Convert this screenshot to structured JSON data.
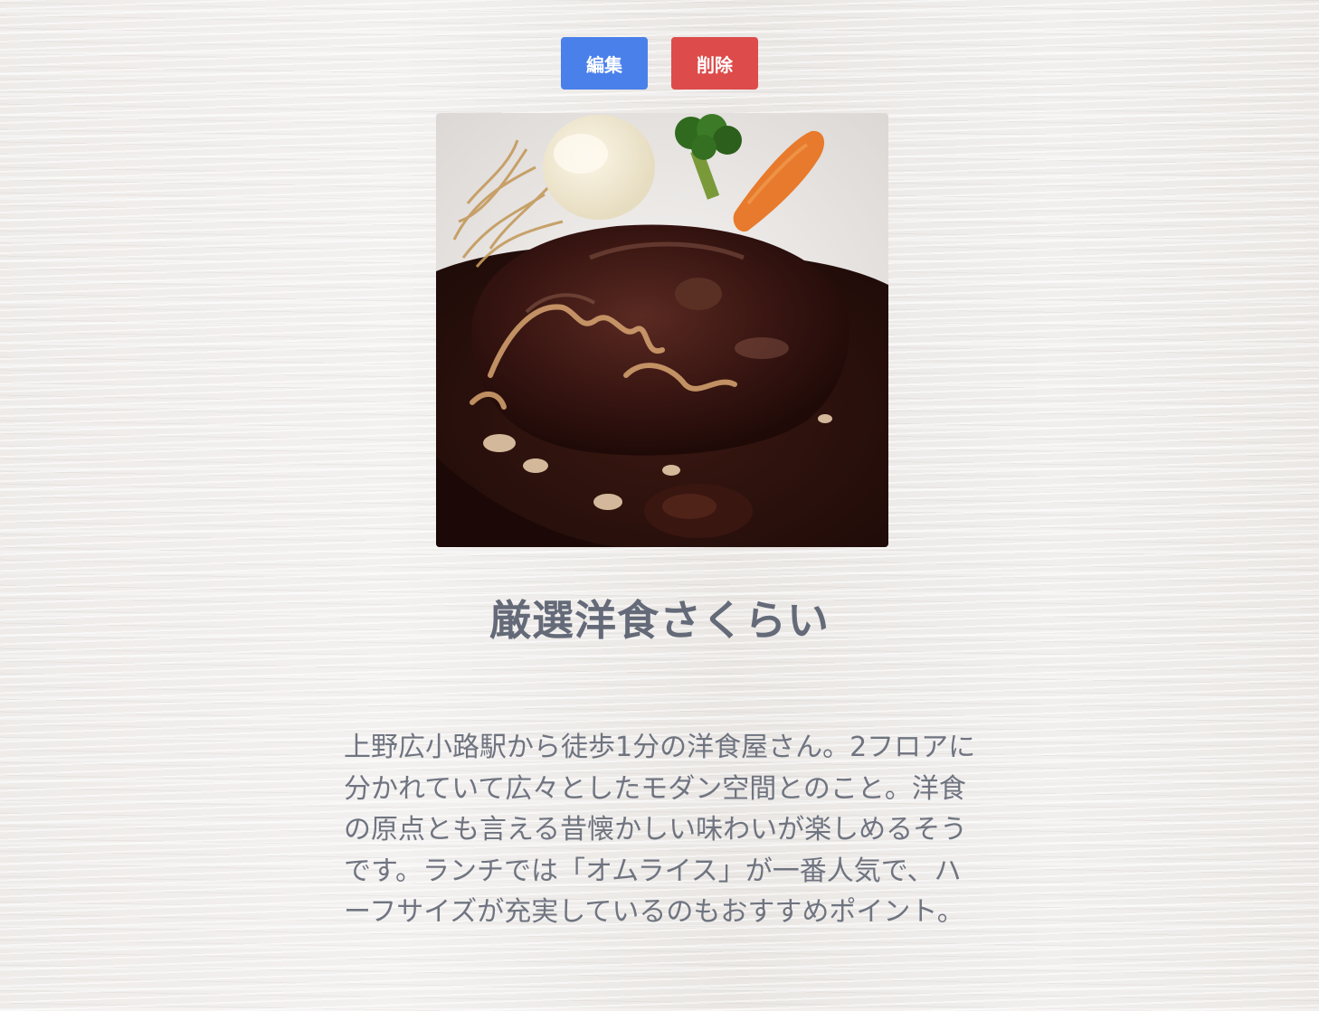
{
  "actions": {
    "edit_label": "編集",
    "delete_label": "削除",
    "edit_color": "#4a80ea",
    "delete_color": "#dd4b4b"
  },
  "restaurant": {
    "photo_alt": "hamburg-steak-dish-photo",
    "name": "厳選洋食さくらい",
    "description": "上野広小路駅から徒歩1分の洋食屋さん。2フロアに分かれていて広々としたモダン空間とのこと。洋食の原点とも言える昔懐かしい味わいが楽しめるそうです。ランチでは「オムライス」が一番人気で、ハーフサイズが充実しているのもおすすめポイント。"
  },
  "colors": {
    "title_text": "#646a78",
    "body_text": "#6f7480"
  }
}
